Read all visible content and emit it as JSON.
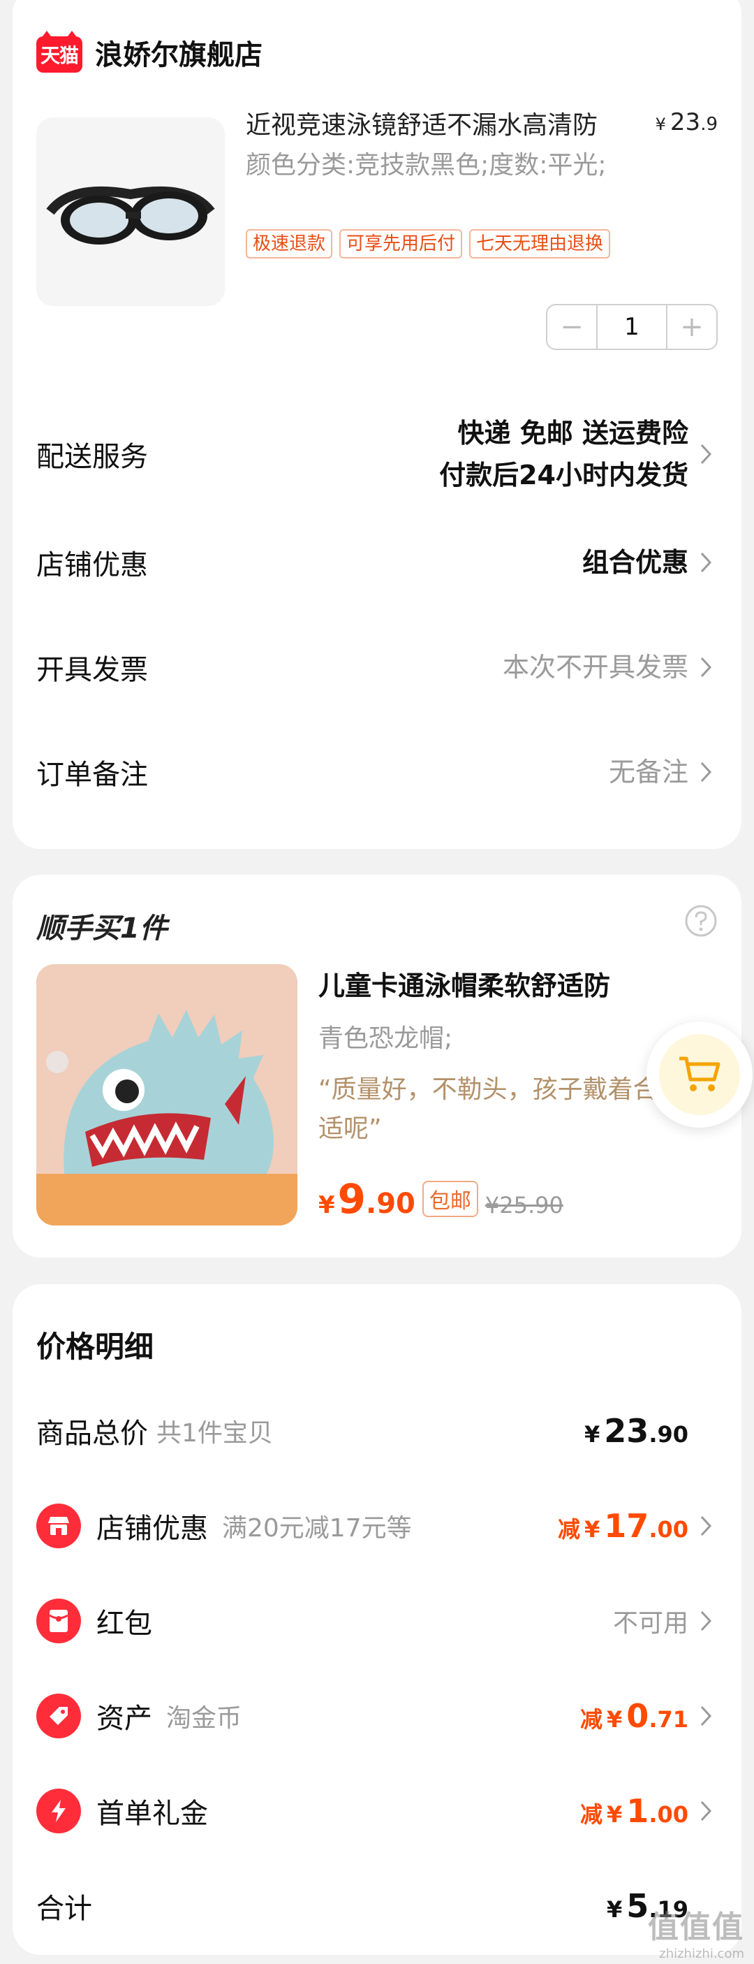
{
  "store": {
    "logo_text": "天猫",
    "name": "浪娇尔旗舰店"
  },
  "product": {
    "title": "近视竞速泳镜舒适不漏水高清防",
    "price_symbol": "¥",
    "price_int": "23",
    "price_dec": ".9",
    "sku": "颜色分类:竞技款黑色;度数:平光;",
    "tags": [
      "极速退款",
      "可享先用后付",
      "七天无理由退换"
    ],
    "quantity": "1",
    "minus": "−",
    "plus": "+"
  },
  "delivery": {
    "label": "配送服务",
    "line1": "快递 免邮 送运费险",
    "line2": "付款后24小时内发货"
  },
  "store_discount": {
    "label": "店铺优惠",
    "value": "组合优惠"
  },
  "invoice": {
    "label": "开具发票",
    "value": "本次不开具发票"
  },
  "remark": {
    "label": "订单备注",
    "value": "无备注"
  },
  "recommend": {
    "title": "顺手买1件",
    "name": "儿童卡通泳帽柔软舒适防",
    "sku": "青色恐龙帽;",
    "review": "“质量好，不勒头，孩子戴着合适呢”",
    "price_symbol": "¥",
    "price_int": "9",
    "price_dec": ".90",
    "badge": "包邮",
    "orig_price": "¥25.90"
  },
  "price_detail": {
    "title": "价格明细",
    "total": {
      "label": "商品总价",
      "sub": "共1件宝贝",
      "symbol": "¥",
      "int": "23",
      "dec": ".90"
    },
    "shop_coupon": {
      "label": "店铺优惠",
      "sub": "满20元减17元等",
      "prefix": "减",
      "symbol": "¥",
      "int": "17",
      "dec": ".00"
    },
    "red_packet": {
      "label": "红包",
      "value": "不可用"
    },
    "asset": {
      "label": "资产",
      "sub": "淘金币",
      "prefix": "减",
      "symbol": "¥",
      "int": "0",
      "dec": ".71"
    },
    "first_order": {
      "label": "首单礼金",
      "prefix": "减",
      "symbol": "¥",
      "int": "1",
      "dec": ".00"
    },
    "sum": {
      "label": "合计",
      "symbol": "¥",
      "int": "5",
      "dec": ".19"
    }
  },
  "watermark": {
    "big": "值值值",
    "small": "zhizhizhi.com"
  },
  "colors": {
    "tmall_red": "#ff1b2d",
    "accent_orange": "#ff4a00",
    "tag_orange": "#e84f16",
    "review_tan": "#b3916a",
    "icon_red": "#ff2d3a"
  }
}
